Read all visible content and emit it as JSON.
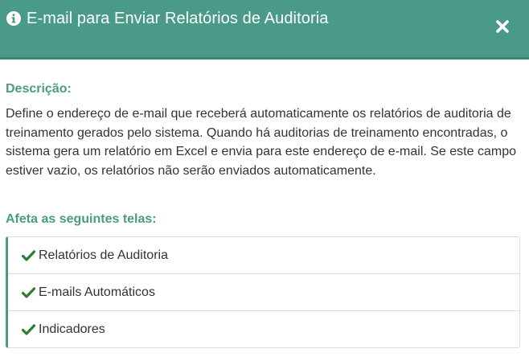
{
  "dialog": {
    "title": "E-mail para Enviar Relatórios de Auditoria",
    "title_icon": "info-circle-icon",
    "close_icon": "close-icon",
    "accent_color": "#4a9a8a",
    "check_color": "#2e7d32"
  },
  "description": {
    "label": "Descrição:",
    "text": "Define o endereço de e-mail que receberá automaticamente os relatórios de auditoria de treinamento gerados pelo sistema. Quando há auditorias de treinamento encontradas, o sistema gera um relatório em Excel e envia para este endereço de e-mail. Se este campo estiver vazio, os relatórios não serão enviados automaticamente."
  },
  "affects": {
    "label": "Afeta as seguintes telas:",
    "items": [
      {
        "label": "Relatórios de Auditoria",
        "icon": "check-icon"
      },
      {
        "label": "E-mails Automáticos",
        "icon": "check-icon"
      },
      {
        "label": "Indicadores",
        "icon": "check-icon"
      }
    ]
  }
}
